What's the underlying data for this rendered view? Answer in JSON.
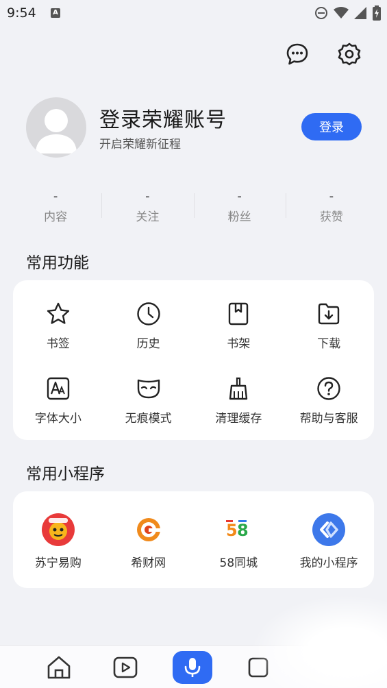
{
  "status_bar": {
    "time": "9:54",
    "a_icon": "A"
  },
  "header": {
    "icons": [
      "message-icon",
      "settings-icon"
    ]
  },
  "profile": {
    "title": "登录荣耀账号",
    "subtitle": "开启荣耀新征程",
    "login_label": "登录",
    "avatar_icon": "default-avatar-icon"
  },
  "stats": [
    {
      "value": "-",
      "label": "内容"
    },
    {
      "value": "-",
      "label": "关注"
    },
    {
      "value": "-",
      "label": "粉丝"
    },
    {
      "value": "-",
      "label": "获赞"
    }
  ],
  "common_functions": {
    "title": "常用功能",
    "items": [
      {
        "label": "书签",
        "icon": "star-icon"
      },
      {
        "label": "历史",
        "icon": "clock-icon"
      },
      {
        "label": "书架",
        "icon": "bookshelf-icon"
      },
      {
        "label": "下载",
        "icon": "download-icon"
      },
      {
        "label": "字体大小",
        "icon": "font-size-icon"
      },
      {
        "label": "无痕模式",
        "icon": "incognito-mask-icon"
      },
      {
        "label": "清理缓存",
        "icon": "broom-icon"
      },
      {
        "label": "帮助与客服",
        "icon": "help-icon"
      }
    ]
  },
  "mini_programs": {
    "title": "常用小程序",
    "items": [
      {
        "label": "苏宁易购",
        "icon": "suning-logo-icon",
        "color": "#e83a3a"
      },
      {
        "label": "希财网",
        "icon": "xicai-logo-icon",
        "color": "#f08a1c"
      },
      {
        "label": "58同城",
        "icon": "58-logo-icon",
        "color": "#2aa84a"
      },
      {
        "label": "我的小程序",
        "icon": "mini-program-icon",
        "color": "#3d78ea"
      }
    ]
  },
  "bottom_nav": {
    "icons": [
      "home-icon",
      "video-icon",
      "microphone-icon",
      "tabs-icon"
    ]
  },
  "colors": {
    "accent": "#2f6bf3",
    "background": "#f1f2f6",
    "card": "#ffffff"
  }
}
